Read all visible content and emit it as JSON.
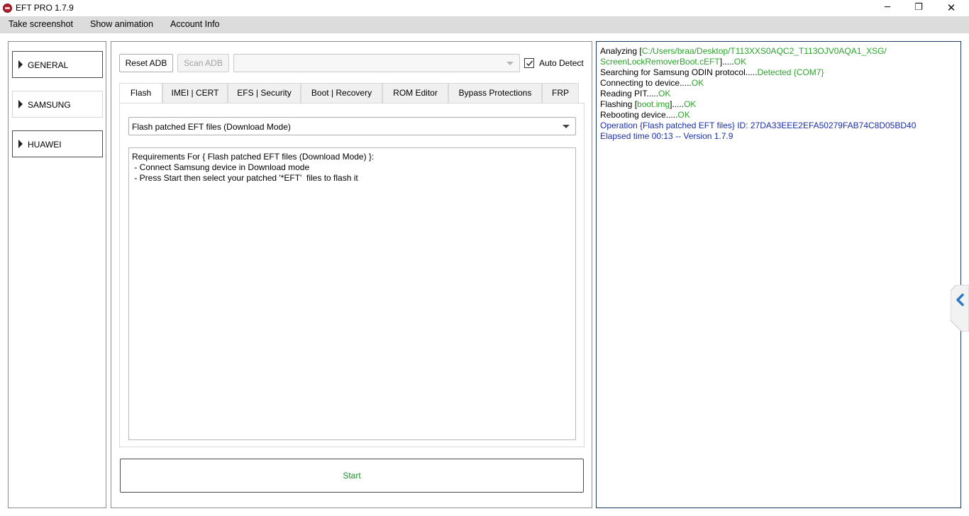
{
  "window": {
    "title": "EFT PRO 1.7.9",
    "minimize_glyph": "─",
    "maximize_glyph": "❐",
    "close_glyph": "✕"
  },
  "menu": {
    "items": [
      "Take screenshot",
      "Show animation",
      "Account Info"
    ]
  },
  "sidebar": {
    "items": [
      {
        "label": "GENERAL",
        "active": true
      },
      {
        "label": "SAMSUNG",
        "active": false
      },
      {
        "label": "HUAWEI",
        "active": true
      }
    ]
  },
  "toolbar": {
    "reset_adb": "Reset ADB",
    "scan_adb": "Scan ADB",
    "device_select": "",
    "auto_detect_label": "Auto Detect",
    "auto_detect_checked": true
  },
  "tabs": [
    {
      "label": "Flash",
      "active": true
    },
    {
      "label": "IMEI | CERT",
      "active": false
    },
    {
      "label": "EFS | Security",
      "active": false
    },
    {
      "label": "Boot | Recovery",
      "active": false
    },
    {
      "label": "ROM Editor",
      "active": false
    },
    {
      "label": "Bypass Protections",
      "active": false
    },
    {
      "label": "FRP",
      "active": false
    }
  ],
  "flash": {
    "operation_selected": "Flash patched EFT files (Download Mode)",
    "requirements": [
      "Requirements For { Flash patched EFT files (Download Mode) }:",
      " - Connect Samsung device in Download mode",
      " - Press Start then select your patched '*EFT'  files to flash it"
    ],
    "start_label": "Start"
  },
  "log": {
    "line1_prefix": "Analyzing [",
    "line1_path": "C:/Users/braa/Desktop/T113XXS0AQC2_T113OJV0AQA1_XSG/",
    "line2_path": "ScreenLockRemoverBoot.cEFT",
    "line2_suffix": "].....",
    "line2_ok": "OK",
    "line3_text": "Searching for Samsung ODIN protocol.....",
    "line3_status": "Detected {COM7}",
    "line4_text": "Connecting to device.....",
    "line4_ok": "OK",
    "line5_text": "Reading PIT.....",
    "line5_ok": "OK",
    "line6_prefix": "Flashing [",
    "line6_file": "boot.img",
    "line6_suffix": "].....",
    "line6_ok": "OK",
    "line7_text": "Rebooting device.....",
    "line7_ok": "OK",
    "line8_text": "Operation {Flash patched EFT files} ID: 27DA33EEE2EFA50279FAB74C8D05BD40",
    "line9_text": "Elapsed time 00:13 -- Version 1.7.9"
  },
  "colors": {
    "log_ok": "#2aa52a",
    "log_info": "#1a2ea8",
    "start_text": "#1d8c2b",
    "collapse_arrow": "#2a7bc4"
  },
  "icons": {
    "app": "eft-logo-icon",
    "sidebar_arrow": "triangle-right-icon",
    "combo_arrow": "chevron-down-icon",
    "collapse": "chevron-left-icon"
  }
}
